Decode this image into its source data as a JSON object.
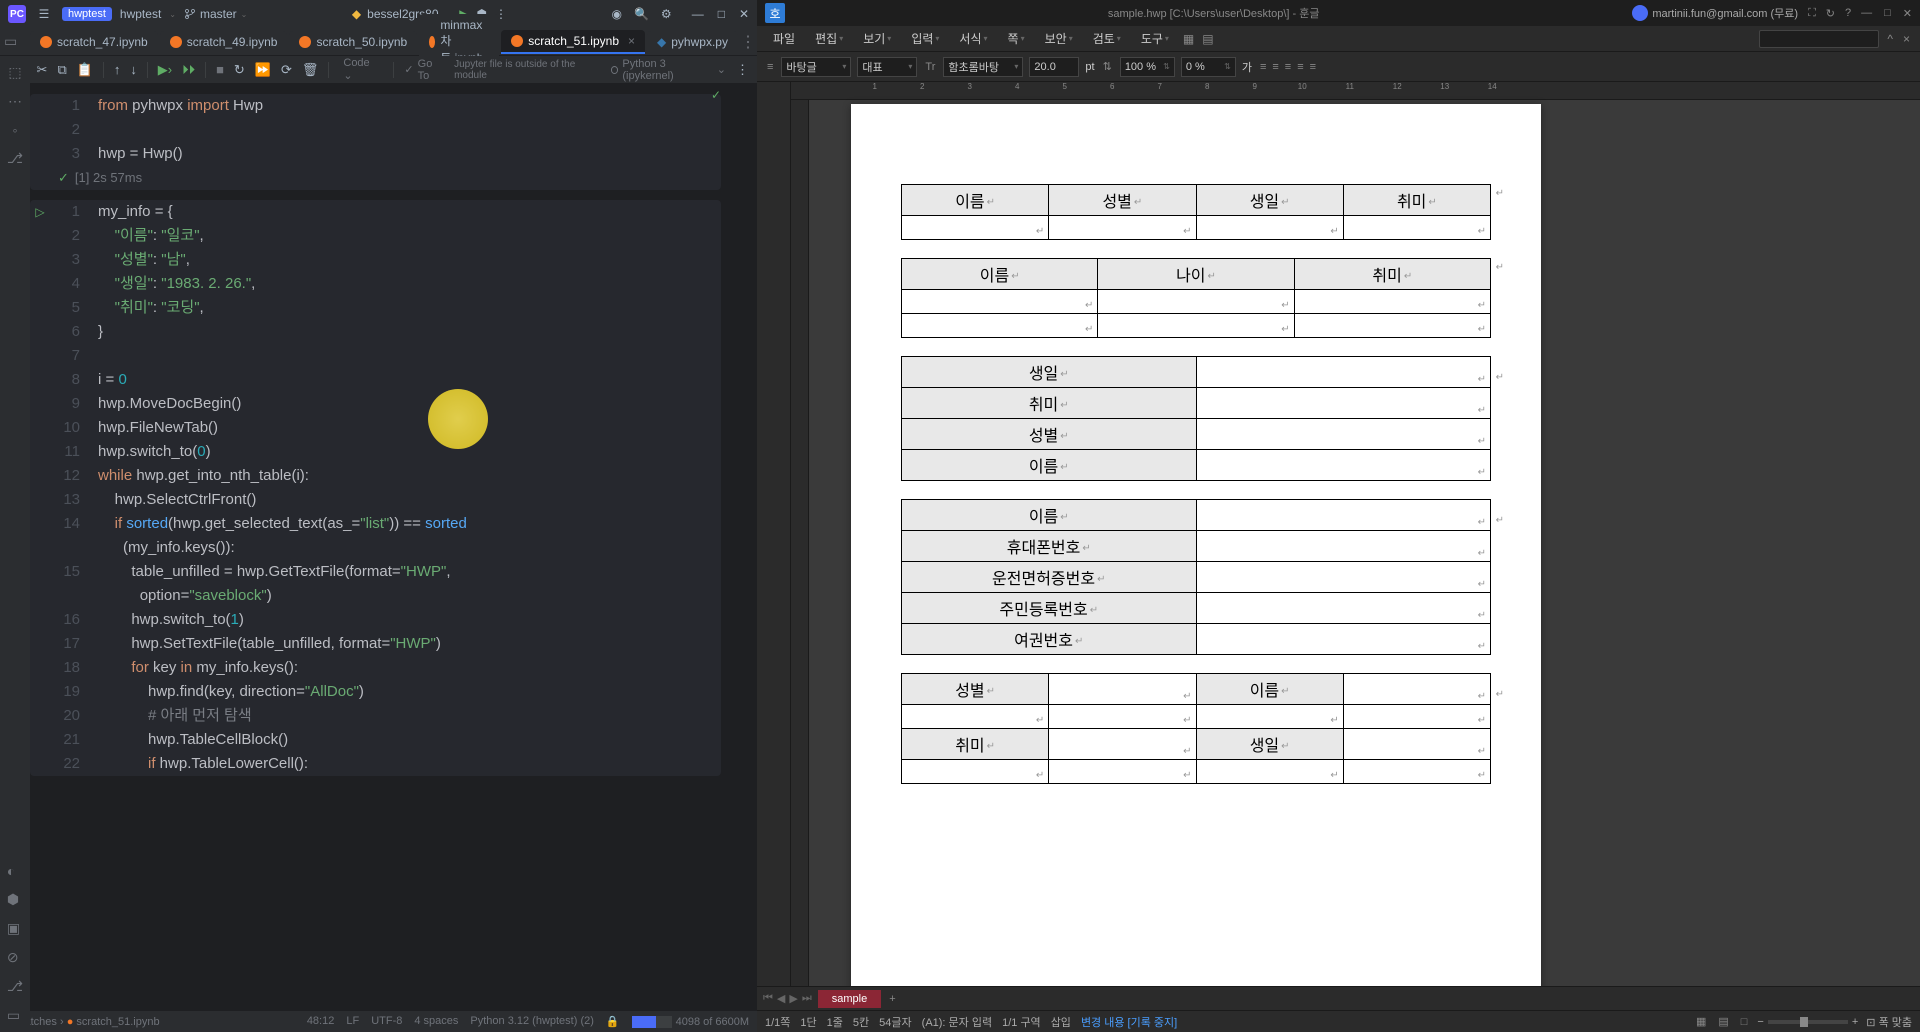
{
  "ide": {
    "project": "hwptest",
    "branch": "master",
    "run_config": "bessel2grs80",
    "tabs": [
      {
        "name": "scratch_47.ipynb"
      },
      {
        "name": "scratch_49.ipynb"
      },
      {
        "name": "scratch_50.ipynb"
      },
      {
        "name": "minmax차트.ipynb"
      },
      {
        "name": "scratch_51.ipynb",
        "active": true
      },
      {
        "name": "pyhwpx.py"
      }
    ],
    "toolbar": {
      "code_label": "Code",
      "goto_label": "Go To",
      "jupyter_msg": "Jupyter file is outside of the module",
      "kernel": "Python 3 (ipykernel)"
    },
    "cell1_out": "[1] 2s 57ms",
    "status": {
      "breadcrumb1": "Scratches",
      "breadcrumb2": "scratch_51.ipynb",
      "pos": "48:12",
      "encoding": "LF",
      "charset": "UTF-8",
      "indent": "4 spaces",
      "interpreter": "Python 3.12 (hwptest) (2)",
      "mem": "4098 of 6600M"
    }
  },
  "code": {
    "c1l1": "from pyhwpx import Hwp",
    "c1l3": "hwp = Hwp()",
    "c2": [
      "my_info = {",
      "    \"이름\": \"일코\",",
      "    \"성별\": \"남\",",
      "    \"생일\": \"1983. 2. 26.\",",
      "    \"취미\": \"코딩\",",
      "}",
      "",
      "i = 0",
      "hwp.MoveDocBegin()",
      "hwp.FileNewTab()",
      "hwp.switch_to(0)",
      "while hwp.get_into_nth_table(i):",
      "    hwp.SelectCtrlFront()",
      "    if sorted(hwp.get_selected_text(as_=\"list\")) == sorted",
      "      (my_info.keys()):",
      "        table_unfilled = hwp.GetTextFile(format=\"HWP\",",
      "          option=\"saveblock\")",
      "        hwp.switch_to(1)",
      "        hwp.SetTextFile(table_unfilled, format=\"HWP\")",
      "        for key in my_info.keys():",
      "            hwp.find(key, direction=\"AllDoc\")",
      "            # 아래 먼저 탐색",
      "            hwp.TableCellBlock()",
      "            if hwp.TableLowerCell():"
    ]
  },
  "hwp": {
    "title": "sample.hwp [C:\\Users\\user\\Desktop\\] - 훈글",
    "user": "martinii.fun@gmail.com (무료)",
    "menus": [
      "파일",
      "편집",
      "보기",
      "입력",
      "서식",
      "쪽",
      "보안",
      "검토",
      "도구"
    ],
    "toolbar": {
      "style": "바탕글",
      "para": "대표",
      "font": "함초롬바탕",
      "size": "20.0",
      "unit": "pt",
      "width": "100 %",
      "spacing": "0 %",
      "align_label": "가"
    },
    "tables": {
      "t1": [
        "이름",
        "성별",
        "생일",
        "취미"
      ],
      "t2": [
        "이름",
        "나이",
        "취미"
      ],
      "t3": [
        "생일",
        "취미",
        "성별",
        "이름"
      ],
      "t4": [
        "이름",
        "휴대폰번호",
        "운전면허증번호",
        "주민등록번호",
        "여권번호"
      ],
      "t5r1": [
        "성별",
        "이름"
      ],
      "t5r2": [
        "취미",
        "생일"
      ]
    },
    "doc_tab": "sample",
    "status": {
      "page": "1/1쪽",
      "dan": "1단",
      "line": "1줄",
      "col": "5칸",
      "chars": "54글자",
      "cell": "(A1): 문자 입력",
      "section": "1/1 구역",
      "mode": "삽입",
      "tracking": "변경 내용 [기록 중지]",
      "zoom": "폭 맞춤"
    }
  }
}
